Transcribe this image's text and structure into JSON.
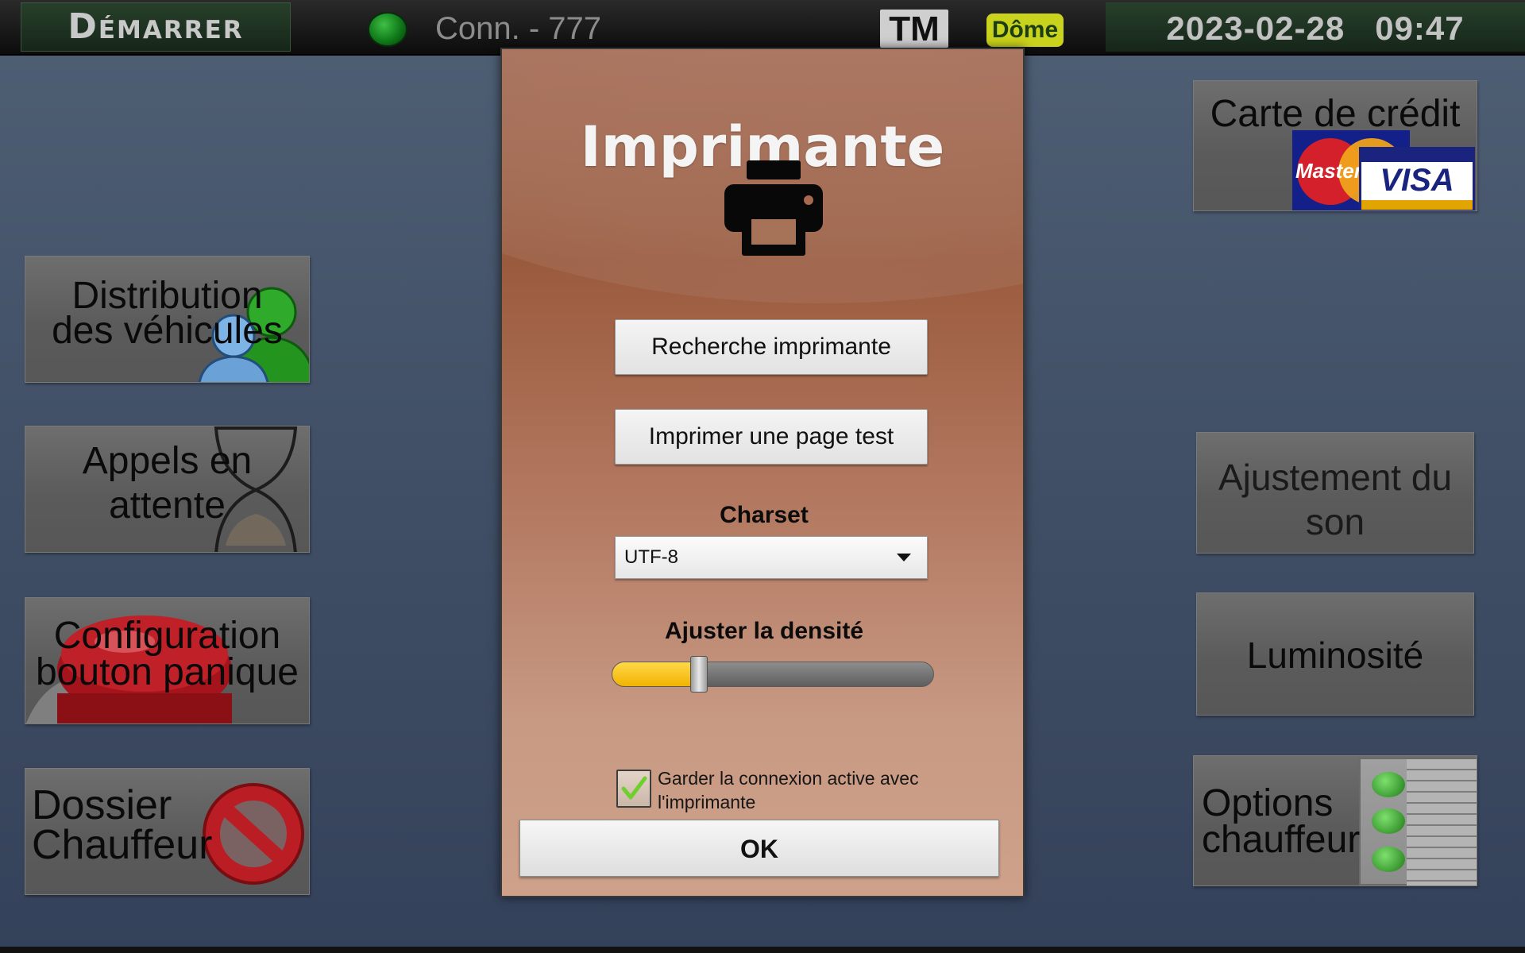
{
  "topbar": {
    "start_label": "Démarrer",
    "connection_text": "Conn. - 777",
    "tm_badge": "TM",
    "dome_badge": "Dôme",
    "date": "2023-02-28",
    "time": "09:47"
  },
  "left_tiles": [
    {
      "label_line1": "Distribution",
      "label_line2": "des véhicules",
      "icon": "users-icon"
    },
    {
      "label_line1": "Appels en",
      "label_line2": "attente",
      "icon": "hourglass-icon"
    },
    {
      "label_line1": "Configuration",
      "label_line2": "bouton panique",
      "icon": "panic-button-icon"
    },
    {
      "label_line1": "Dossier",
      "label_line2": "Chauffeur",
      "icon": "no-entry-icon"
    }
  ],
  "right_tiles": {
    "credit_card": {
      "label": "Carte de crédit",
      "card1": "Master",
      "card2": "VISA"
    },
    "sound": {
      "label_line1": "Ajustement du",
      "label_line2": "son"
    },
    "brightness": {
      "label": "Luminosité"
    },
    "driver_options": {
      "label_line1": "Options",
      "label_line2": "chauffeur",
      "icon": "checklist-icon"
    }
  },
  "dialog": {
    "title": "Imprimante",
    "icon": "printer-icon",
    "search_button": "Recherche imprimante",
    "test_button": "Imprimer une page test",
    "charset_label": "Charset",
    "charset_value": "UTF-8",
    "density_label": "Ajuster la densité",
    "density_level": 0.27,
    "keep_connection_checked": true,
    "keep_connection_label": "Garder la connexion active avec l'imprimante",
    "ok_button": "OK"
  },
  "colors": {
    "accent_yellow": "#f1b300",
    "status_green": "#1f9a2a",
    "dome_badge": "#c9d21c",
    "dialog_brown": "#9a5a3d"
  }
}
